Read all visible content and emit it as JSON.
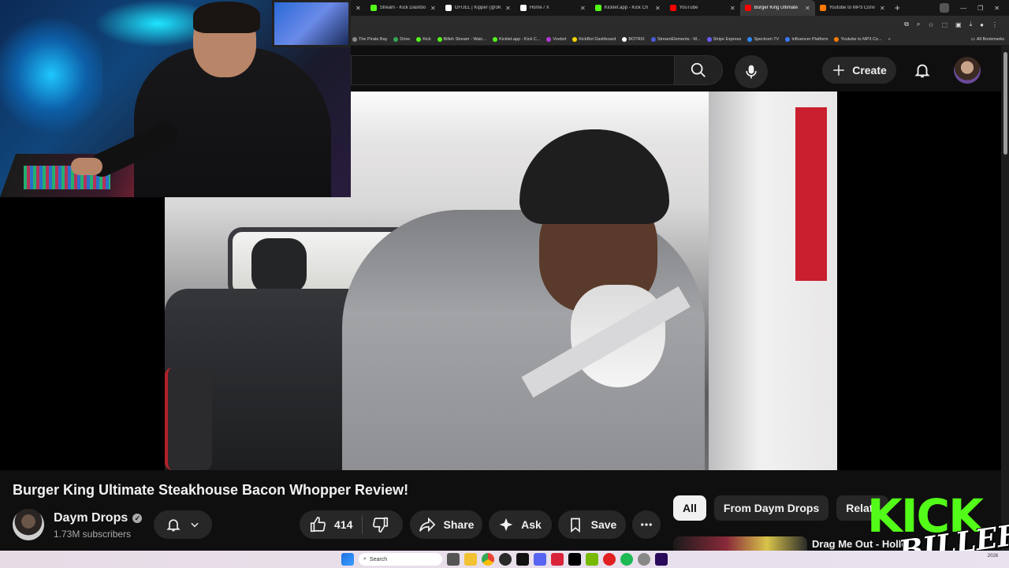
{
  "browser": {
    "tabs": [
      {
        "title": "Stream - Kick Dashbo",
        "favicon": "kick-favicon",
        "color": "#53fc18",
        "active": false
      },
      {
        "title": "GFUEL | Kipper (@oK",
        "favicon": "x-favicon",
        "color": "#ffffff",
        "active": false
      },
      {
        "title": "Home / X",
        "favicon": "x-favicon",
        "color": "#ffffff",
        "active": false
      },
      {
        "title": "Kicklet.app - Kick Ch",
        "favicon": "kicklet-favicon",
        "color": "#53fc18",
        "active": false
      },
      {
        "title": "YouTube",
        "favicon": "youtube-favicon",
        "color": "#ff0000",
        "active": false
      },
      {
        "title": "Burger King Ultimate",
        "favicon": "youtube-favicon",
        "color": "#ff0000",
        "active": true
      },
      {
        "title": "Youtube to MP3 Conv",
        "favicon": "converter-favicon",
        "color": "#ff7a00",
        "active": false
      }
    ],
    "bookmarks": [
      {
        "label": "The Pirate Bay",
        "color": "#888888"
      },
      {
        "label": "Drive",
        "color": "#34a853"
      },
      {
        "label": "Kick",
        "color": "#53fc18"
      },
      {
        "label": "Billeh Stream - Watc...",
        "color": "#53fc18"
      },
      {
        "label": "Kicklet.app - Kick C...",
        "color": "#53fc18"
      },
      {
        "label": "Voxbot",
        "color": "#b23ad8"
      },
      {
        "label": "KickBot Dashboard",
        "color": "#ffd400"
      },
      {
        "label": "BOTRIX",
        "color": "#ffffff"
      },
      {
        "label": "StreamElements - M...",
        "color": "#4a5bd8"
      },
      {
        "label": "Stripe Express",
        "color": "#6a5bff"
      },
      {
        "label": "Spectrum TV",
        "color": "#2a8aff"
      },
      {
        "label": "Influencer Platform",
        "color": "#3a7aff"
      },
      {
        "label": "Youtube to MP3 Co...",
        "color": "#ff7a00"
      }
    ],
    "all_bookmarks_label": "All Bookmarks"
  },
  "header": {
    "create_label": "Create"
  },
  "video": {
    "title": "Burger King Ultimate Steakhouse Bacon Whopper Review!",
    "channel": "Daym Drops",
    "subscribers": "1.73M subscribers",
    "likes": "414",
    "share_label": "Share",
    "ask_label": "Ask",
    "save_label": "Save"
  },
  "related": {
    "chips": [
      "All",
      "From Daym Drops",
      "Relate"
    ],
    "first_title": "Drag Me Out - Hollo"
  },
  "overlay": {
    "kick_text": "KICK",
    "billeh_text": "BILLEH"
  },
  "taskbar": {
    "search_label": "Search",
    "date": "2026"
  },
  "colors": {
    "kick_green": "#53fc18",
    "youtube_bg": "#0f0f0f",
    "pill_bg": "#272727"
  }
}
